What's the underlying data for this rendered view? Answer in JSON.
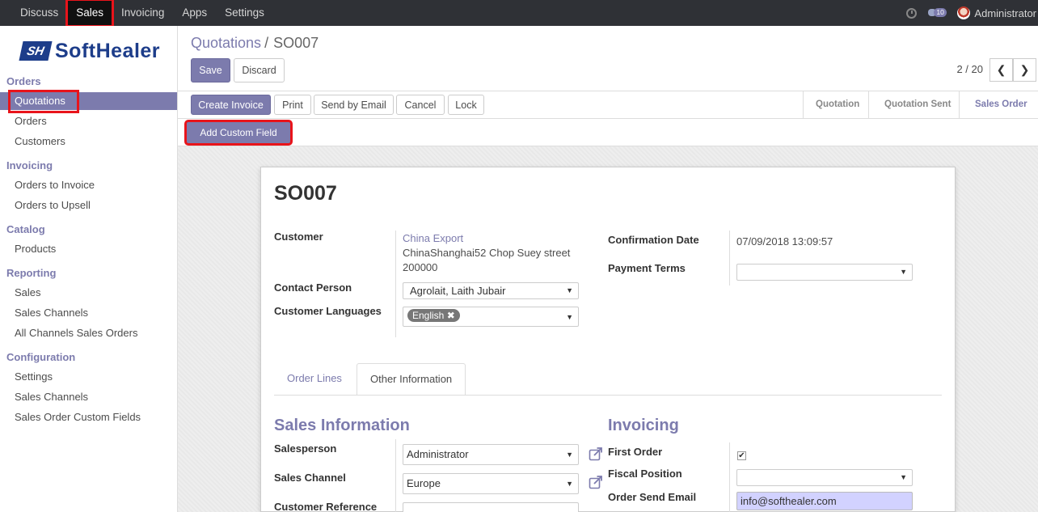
{
  "topnav": {
    "items": [
      "Discuss",
      "Sales",
      "Invoicing",
      "Apps",
      "Settings"
    ],
    "active": "Sales",
    "chat_count": "10",
    "user": "Administrator"
  },
  "brand": {
    "logo_mark": "SH",
    "logo_text": "SoftHealer"
  },
  "sidebar": {
    "sections": [
      {
        "title": "Orders",
        "items": [
          "Quotations",
          "Orders",
          "Customers"
        ]
      },
      {
        "title": "Invoicing",
        "items": [
          "Orders to Invoice",
          "Orders to Upsell"
        ]
      },
      {
        "title": "Catalog",
        "items": [
          "Products"
        ]
      },
      {
        "title": "Reporting",
        "items": [
          "Sales",
          "Sales Channels",
          "All Channels Sales Orders"
        ]
      },
      {
        "title": "Configuration",
        "items": [
          "Settings",
          "Sales Channels",
          "Sales Order Custom Fields"
        ]
      }
    ],
    "active_item": "Quotations"
  },
  "control_panel": {
    "breadcrumb_parent": "Quotations",
    "breadcrumb_sep": "/",
    "breadcrumb_current": "SO007",
    "save_label": "Save",
    "discard_label": "Discard",
    "pager": "2 / 20"
  },
  "statusbar": {
    "buttons": [
      "Create Invoice",
      "Print",
      "Send by Email",
      "Cancel",
      "Lock"
    ],
    "stages": [
      "Quotation",
      "Quotation Sent",
      "Sales Order"
    ],
    "current_stage": "Sales Order"
  },
  "custom_field_button": "Add Custom Field",
  "form": {
    "title": "SO007",
    "customer_label": "Customer",
    "customer_name": "China Export",
    "customer_address_1": "ChinaShanghai52 Chop Suey street",
    "customer_address_2": "200000",
    "contact_label": "Contact Person",
    "contact_value": "Agrolait, Laith Jubair",
    "languages_label": "Customer Languages",
    "languages_tag": "English",
    "confirmation_label": "Confirmation Date",
    "confirmation_value": "07/09/2018 13:09:57",
    "payment_terms_label": "Payment Terms",
    "payment_terms_value": "",
    "tabs": [
      "Order Lines",
      "Other Information"
    ],
    "active_tab": "Other Information",
    "sales_info_title": "Sales Information",
    "salesperson_label": "Salesperson",
    "salesperson_value": "Administrator",
    "sales_channel_label": "Sales Channel",
    "sales_channel_value": "Europe",
    "customer_ref_label": "Customer Reference",
    "invoicing_title": "Invoicing",
    "first_order_label": "First Order",
    "first_order_checked": true,
    "fiscal_position_label": "Fiscal Position",
    "fiscal_position_value": "",
    "send_email_label": "Order Send Email",
    "send_email_value": "info@softhealer.com"
  },
  "colors": {
    "accent": "#7c7bad",
    "highlight": "#e8141b",
    "topbar": "#2f3136"
  }
}
